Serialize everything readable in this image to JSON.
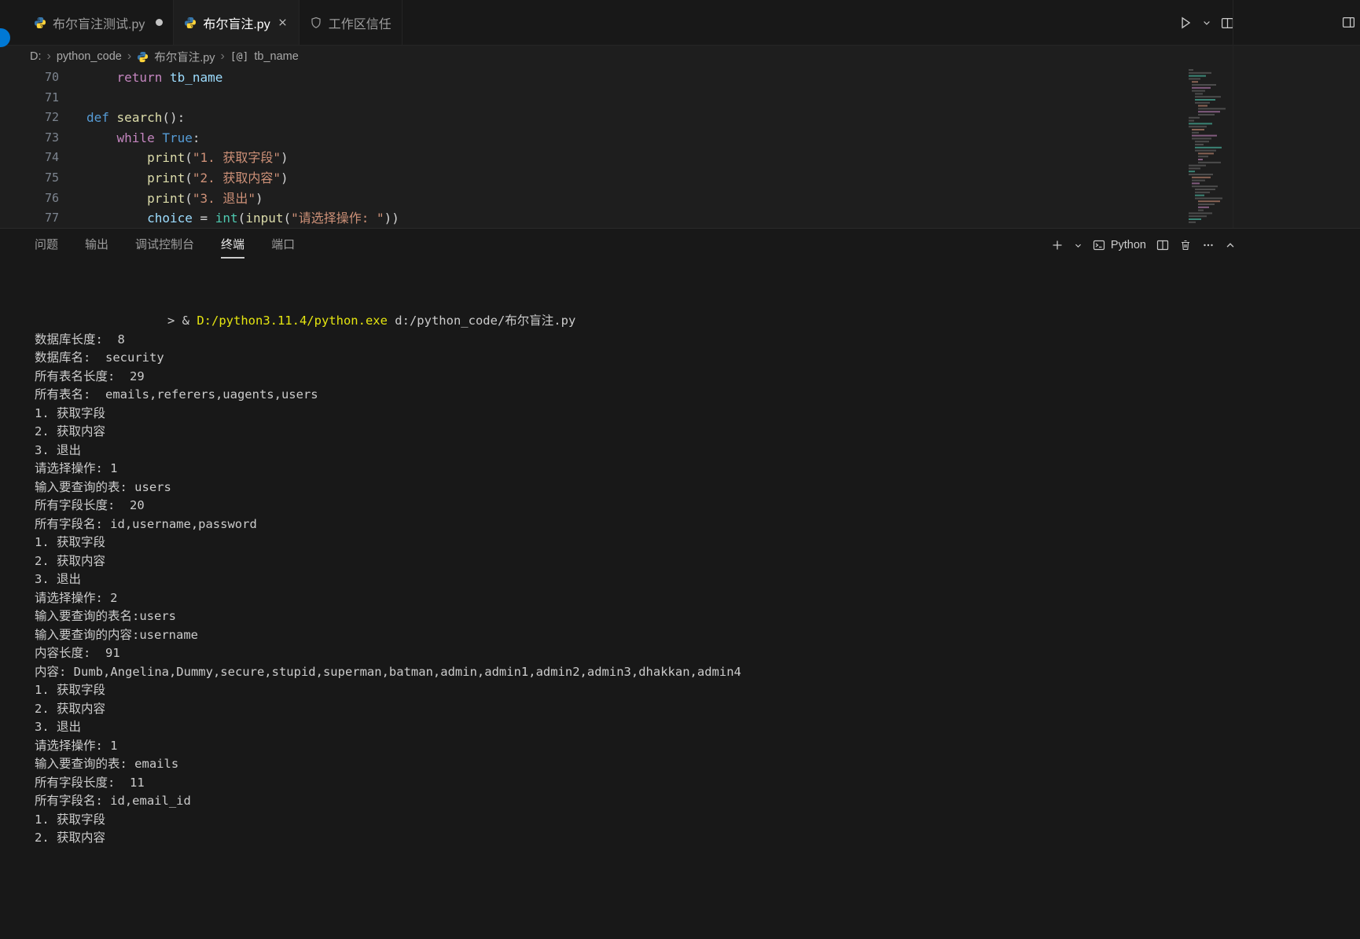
{
  "colors": {
    "accent_blue": "#0078d4",
    "terminal_command_yellow": "#e5e510",
    "python_icon_blue": "#3776ab",
    "python_icon_yellow": "#ffd43b",
    "string_orange": "#ce9178",
    "keyword_blue": "#569cd6",
    "keyword_purple": "#c586c0"
  },
  "icons": {
    "symbol_variable": "[@]"
  },
  "tabs": [
    {
      "label": "布尔盲注测试.py",
      "state": "modified"
    },
    {
      "label": "布尔盲注.py",
      "state": "active"
    },
    {
      "label": "工作区信任",
      "state": "normal"
    }
  ],
  "breadcrumb": {
    "drive": "D:",
    "folder": "python_code",
    "file": "布尔盲注.py",
    "symbol": "tb_name"
  },
  "editor": {
    "lines": [
      {
        "num": "70",
        "tokens": [
          {
            "t": "    "
          },
          {
            "t": "return",
            "c": "kw2"
          },
          {
            "t": " "
          },
          {
            "t": "tb_name",
            "c": "var"
          }
        ]
      },
      {
        "num": "71",
        "tokens": []
      },
      {
        "num": "72",
        "tokens": [
          {
            "t": "def",
            "c": "kw1"
          },
          {
            "t": " "
          },
          {
            "t": "search",
            "c": "fn"
          },
          {
            "t": "():"
          }
        ]
      },
      {
        "num": "73",
        "tokens": [
          {
            "t": "    "
          },
          {
            "t": "while",
            "c": "kw2"
          },
          {
            "t": " "
          },
          {
            "t": "True",
            "c": "kw1"
          },
          {
            "t": ":"
          }
        ]
      },
      {
        "num": "74",
        "tokens": [
          {
            "t": "        "
          },
          {
            "t": "print",
            "c": "fn"
          },
          {
            "t": "("
          },
          {
            "t": "\"1. 获取字段\"",
            "c": "str"
          },
          {
            "t": ")"
          }
        ]
      },
      {
        "num": "75",
        "tokens": [
          {
            "t": "        "
          },
          {
            "t": "print",
            "c": "fn"
          },
          {
            "t": "("
          },
          {
            "t": "\"2. 获取内容\"",
            "c": "str"
          },
          {
            "t": ")"
          }
        ]
      },
      {
        "num": "76",
        "tokens": [
          {
            "t": "        "
          },
          {
            "t": "print",
            "c": "fn"
          },
          {
            "t": "("
          },
          {
            "t": "\"3. 退出\"",
            "c": "str"
          },
          {
            "t": ")"
          }
        ]
      },
      {
        "num": "77",
        "tokens": [
          {
            "t": "        "
          },
          {
            "t": "choice",
            "c": "var"
          },
          {
            "t": " = "
          },
          {
            "t": "int",
            "c": "type"
          },
          {
            "t": "("
          },
          {
            "t": "input",
            "c": "fn"
          },
          {
            "t": "("
          },
          {
            "t": "\"请选择操作: \"",
            "c": "str"
          },
          {
            "t": "))"
          }
        ]
      }
    ]
  },
  "panel": {
    "tabs": [
      "问题",
      "输出",
      "调试控制台",
      "终端",
      "端口"
    ],
    "active_tab": "终端",
    "toolbar": {
      "shell_label": "Python"
    }
  },
  "terminal": {
    "lines": [
      {
        "indent": true,
        "s": [
          {
            "t": "> & "
          },
          {
            "t": "D:/python3.11.4/python.exe",
            "c": "yellow"
          },
          {
            "t": " d:/python_code/布尔盲注.py"
          }
        ]
      },
      {
        "s": [
          {
            "t": "数据库长度:  8"
          }
        ]
      },
      {
        "s": [
          {
            "t": "数据库名:  security"
          }
        ]
      },
      {
        "s": [
          {
            "t": "所有表名长度:  29"
          }
        ]
      },
      {
        "s": [
          {
            "t": "所有表名:  emails,referers,uagents,users"
          }
        ]
      },
      {
        "s": [
          {
            "t": "1. 获取字段"
          }
        ]
      },
      {
        "s": [
          {
            "t": "2. 获取内容"
          }
        ]
      },
      {
        "s": [
          {
            "t": "3. 退出"
          }
        ]
      },
      {
        "s": [
          {
            "t": "请选择操作: 1"
          }
        ]
      },
      {
        "s": [
          {
            "t": "输入要查询的表: users"
          }
        ]
      },
      {
        "s": [
          {
            "t": "所有字段长度:  20"
          }
        ]
      },
      {
        "s": [
          {
            "t": "所有字段名: id,username,password"
          }
        ]
      },
      {
        "s": [
          {
            "t": "1. 获取字段"
          }
        ]
      },
      {
        "s": [
          {
            "t": "2. 获取内容"
          }
        ]
      },
      {
        "s": [
          {
            "t": "3. 退出"
          }
        ]
      },
      {
        "s": [
          {
            "t": "请选择操作: 2"
          }
        ]
      },
      {
        "s": [
          {
            "t": "输入要查询的表名:users"
          }
        ]
      },
      {
        "s": [
          {
            "t": "输入要查询的内容:username"
          }
        ]
      },
      {
        "s": [
          {
            "t": "内容长度:  91"
          }
        ]
      },
      {
        "s": [
          {
            "t": "内容: Dumb,Angelina,Dummy,secure,stupid,superman,batman,admin,admin1,admin2,admin3,dhakkan,admin4"
          }
        ]
      },
      {
        "s": [
          {
            "t": "1. 获取字段"
          }
        ]
      },
      {
        "s": [
          {
            "t": "2. 获取内容"
          }
        ]
      },
      {
        "s": [
          {
            "t": "3. 退出"
          }
        ]
      },
      {
        "s": [
          {
            "t": "请选择操作: 1"
          }
        ]
      },
      {
        "s": [
          {
            "t": "输入要查询的表: emails"
          }
        ]
      },
      {
        "s": [
          {
            "t": "所有字段长度:  11"
          }
        ]
      },
      {
        "s": [
          {
            "t": "所有字段名: id,email_id"
          }
        ]
      },
      {
        "s": [
          {
            "t": "1. 获取字段"
          }
        ]
      },
      {
        "s": [
          {
            "t": "2. 获取内容"
          }
        ]
      }
    ]
  }
}
